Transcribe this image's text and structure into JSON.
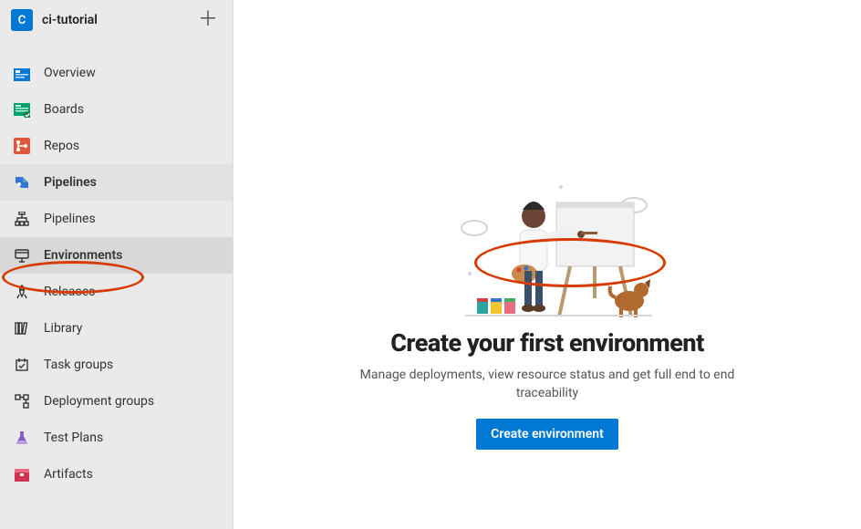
{
  "project": {
    "badge_letter": "C",
    "name": "ci-tutorial"
  },
  "sidebar": {
    "overview": "Overview",
    "boards": "Boards",
    "repos": "Repos",
    "pipelines_section": "Pipelines",
    "pipelines_sub": {
      "pipelines": "Pipelines",
      "environments": "Environments",
      "releases": "Releases",
      "library": "Library",
      "task_groups": "Task groups",
      "deployment_groups": "Deployment groups"
    },
    "test_plans": "Test Plans",
    "artifacts": "Artifacts"
  },
  "main": {
    "title": "Create your first environment",
    "subtitle": "Manage deployments, view resource status and get full end to end traceability",
    "cta": "Create environment"
  }
}
